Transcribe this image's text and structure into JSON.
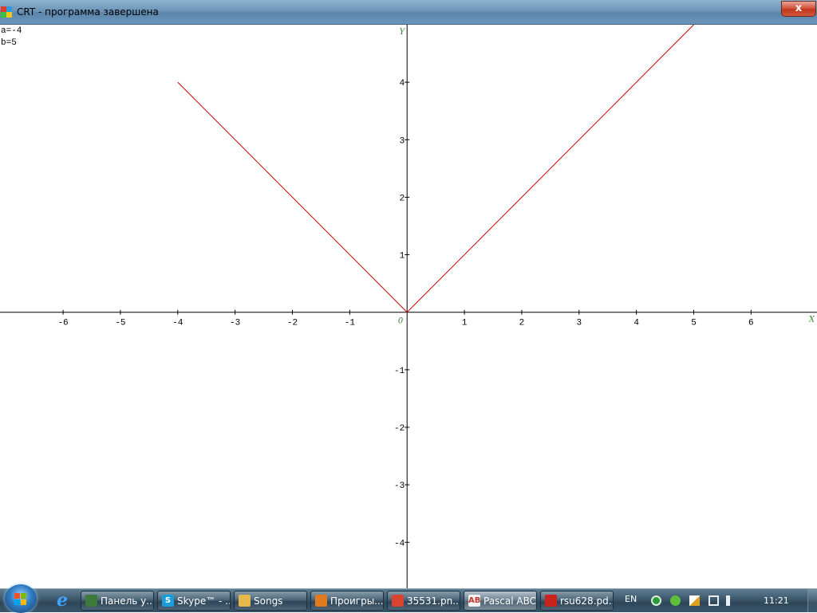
{
  "window": {
    "title": "CRT - программа завершена",
    "close_label": "x"
  },
  "output": {
    "lines": [
      "a=-4",
      "b=5"
    ]
  },
  "chart_data": {
    "type": "line",
    "title": "",
    "xlabel": "X",
    "ylabel": "Y",
    "origin_label": "0",
    "xlim": [
      -7.1,
      7.15
    ],
    "ylim": [
      -4.8,
      5.0
    ],
    "xticks": [
      -6,
      -5,
      -4,
      -3,
      -2,
      -1,
      1,
      2,
      3,
      4,
      5,
      6
    ],
    "yticks": [
      -4,
      -3,
      -2,
      -1,
      1,
      2,
      3,
      4
    ],
    "grid": false,
    "color": "#cc0000",
    "series": [
      {
        "x": [
          -4,
          0,
          5
        ],
        "y": [
          4,
          0,
          5
        ]
      }
    ]
  },
  "taskbar": {
    "start_label": "Start",
    "quick_launch": [
      "internet-explorer"
    ],
    "tasks": [
      {
        "label": "Панель у...",
        "icon": "control-panel-icon",
        "color": "#3b7a3b"
      },
      {
        "label": "Skype™ - ...",
        "icon": "skype-icon",
        "color": "#1a9ddb",
        "glyph": "S"
      },
      {
        "label": "Songs",
        "icon": "folder-icon",
        "color": "#e6b84a"
      },
      {
        "label": "Проигры...",
        "icon": "media-player-icon",
        "color": "#e07a1e"
      },
      {
        "label": "35531.pn...",
        "icon": "chrome-icon",
        "color": "#d9432f"
      },
      {
        "label": "Pascal ABC",
        "icon": "pascal-abc-icon",
        "color": "#f2f2f2",
        "glyph": "AB",
        "active": true
      },
      {
        "label": "rsu628.pd...",
        "icon": "pdf-icon",
        "color": "#c9231c"
      }
    ],
    "language": "EN",
    "clock": "11:21"
  }
}
